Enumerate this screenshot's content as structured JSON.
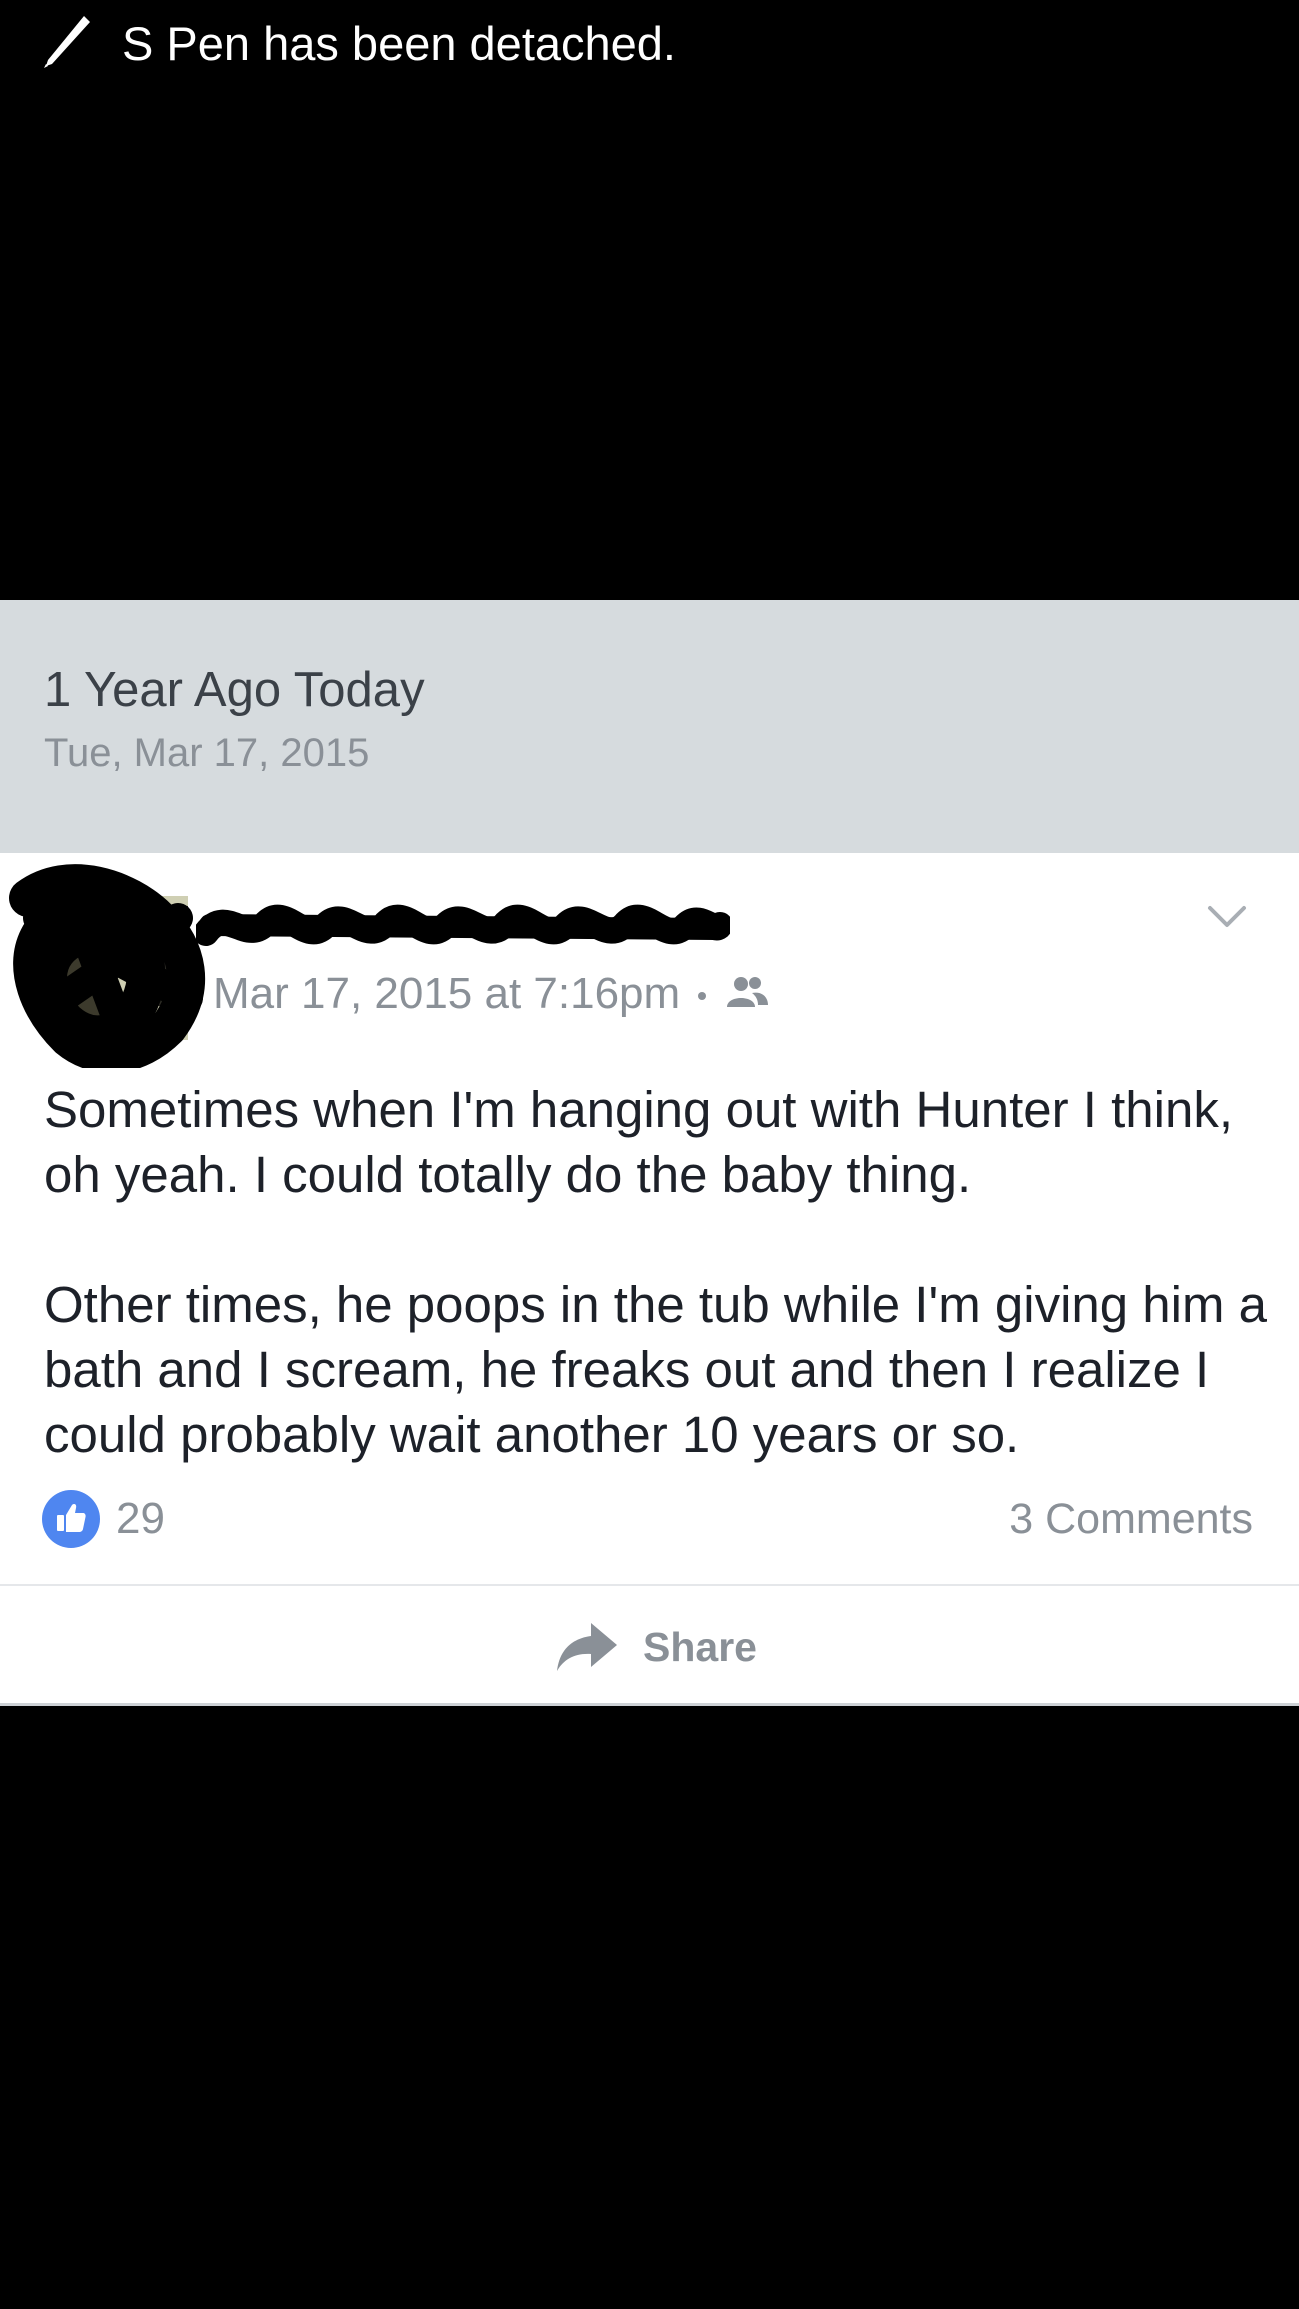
{
  "notification": {
    "icon": "pen-icon",
    "text": "S Pen has been detached."
  },
  "memory": {
    "title": "1 Year Ago Today",
    "date": "Tue, Mar 17, 2015"
  },
  "post": {
    "timestamp": "Mar 17, 2015 at 7:16pm",
    "audience_icon": "friends-icon",
    "menu_icon": "chevron-down-icon",
    "paragraphs": [
      "Sometimes when I'm hanging out with Hunter I think,\noh yeah. I could totally do the baby thing.",
      "Other times, he poops in the tub while I'm giving him a\nbath and I scream, he freaks out and then I realize I\ncould probably wait another 10 years or so."
    ],
    "like_icon": "thumbs-up-icon",
    "like_count": "29",
    "comment_count": "3 Comments",
    "share_label": "Share",
    "share_icon": "share-arrow-icon"
  },
  "colors": {
    "background": "#000000",
    "header_bg": "#d6dbde",
    "card_bg": "#ffffff",
    "like_blue": "#4f86f0",
    "muted_text": "#8a9097",
    "body_text": "#1d2129"
  }
}
